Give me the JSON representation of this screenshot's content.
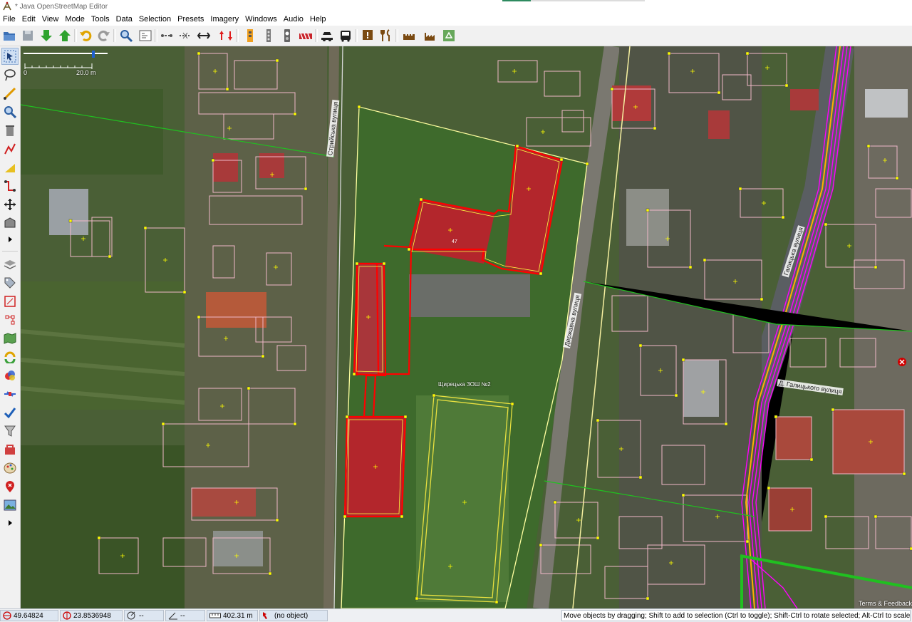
{
  "window": {
    "title": "* Java OpenStreetMap Editor"
  },
  "menu": [
    "File",
    "Edit",
    "View",
    "Mode",
    "Tools",
    "Data",
    "Selection",
    "Presets",
    "Imagery",
    "Windows",
    "Audio",
    "Help"
  ],
  "toolbar": {
    "icons": [
      "open-file-icon",
      "save-icon",
      "download-icon",
      "upload-icon",
      "undo-icon",
      "redo-icon",
      "zoom-preferences-icon",
      "preferences-icon",
      "align-in-line-icon",
      "align-in-circle-icon",
      "split-way-icon",
      "reverse-way-icon",
      "traffic-signals-icon",
      "street-lamp-icon",
      "traffic-light-icon",
      "barrier-icon",
      "car-icon",
      "bus-icon",
      "information-board-icon",
      "restaurant-icon",
      "castle-icon",
      "factory-icon",
      "recycling-icon"
    ]
  },
  "left_toolbar": {
    "icons": [
      "select-mode-icon",
      "lasso-icon",
      "draw-mode-icon",
      "zoom-mode-icon",
      "delete-mode-icon",
      "improve-way-icon",
      "parallel-way-icon",
      "extrude-icon",
      "move-icon",
      "building-tool-icon",
      "more-icon",
      "layers-icon",
      "tags-icon",
      "relations-icon",
      "validator-icon",
      "map-paint-icon",
      "conflict-icon",
      "filter-icon",
      "changeset-icon",
      "authors-icon",
      "toggle-icon",
      "warnings-icon",
      "mappaint-style-icon",
      "notes-icon",
      "image-icon",
      "more-icon"
    ]
  },
  "map": {
    "scale_start": "0",
    "scale_end": "20.0 m",
    "school_label": "Щирецька ЗОШ №2",
    "building_number": "47",
    "streets": [
      "Стрийська вулиця",
      "Державна вулиця",
      "Д. Галицького вулиця",
      "Галицька вулиця"
    ],
    "terms": "Terms & Feedback"
  },
  "status": {
    "lat": "49.64824",
    "lon": "23.8536948",
    "heading": "--",
    "angle": "--",
    "distance": "402.31 m",
    "object": "(no object)",
    "message": "Move objects by dragging; Shift to add to selection (Ctrl to toggle); Shift-Ctrl to rotate selected; Alt-Ctrl to scale selected"
  },
  "colors": {
    "selection": "#ff0000",
    "building_outline": "#f0b8c8",
    "node": "#ffff00",
    "highway_primary": "#ff00ff",
    "boundary": "#00c000",
    "toolbar_bg": "#f1f1f1"
  }
}
